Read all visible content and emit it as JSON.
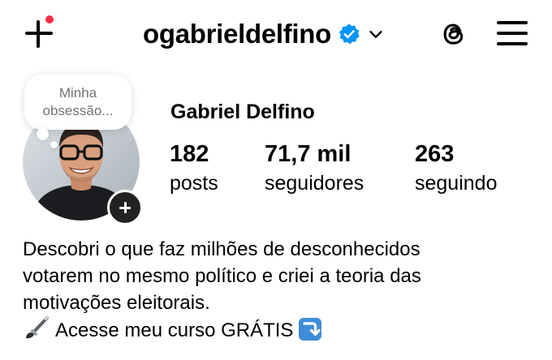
{
  "header": {
    "username": "ogabrieldelfino",
    "icons": {
      "new_post": "plus-icon",
      "verified": "verified-badge-icon",
      "account_switch": "chevron-down-icon",
      "threads": "threads-icon",
      "menu": "hamburger-menu-icon"
    }
  },
  "note": {
    "text": "Minha obsessão..."
  },
  "profile": {
    "full_name": "Gabriel Delfino",
    "stats": [
      {
        "value": "182",
        "label": "posts"
      },
      {
        "value": "71,7 mil",
        "label": "seguidores"
      },
      {
        "value": "263",
        "label": "seguindo"
      }
    ]
  },
  "bio": {
    "lines": [
      "Descobri o que faz milhões de desconhecidos",
      "votarem no mesmo político e criei a teoria das",
      "motivações eleitorais."
    ],
    "cta_text": "Acesse meu curso GRÁTIS",
    "cta_icons": [
      "paintbrush-icon",
      "arrow-down-right-icon"
    ]
  },
  "colors": {
    "notification_dot": "#ff2d45",
    "verified_badge": "#0095f6",
    "text": "#000000",
    "note_text": "#737373",
    "arrow_box": "#3f8cd9"
  }
}
